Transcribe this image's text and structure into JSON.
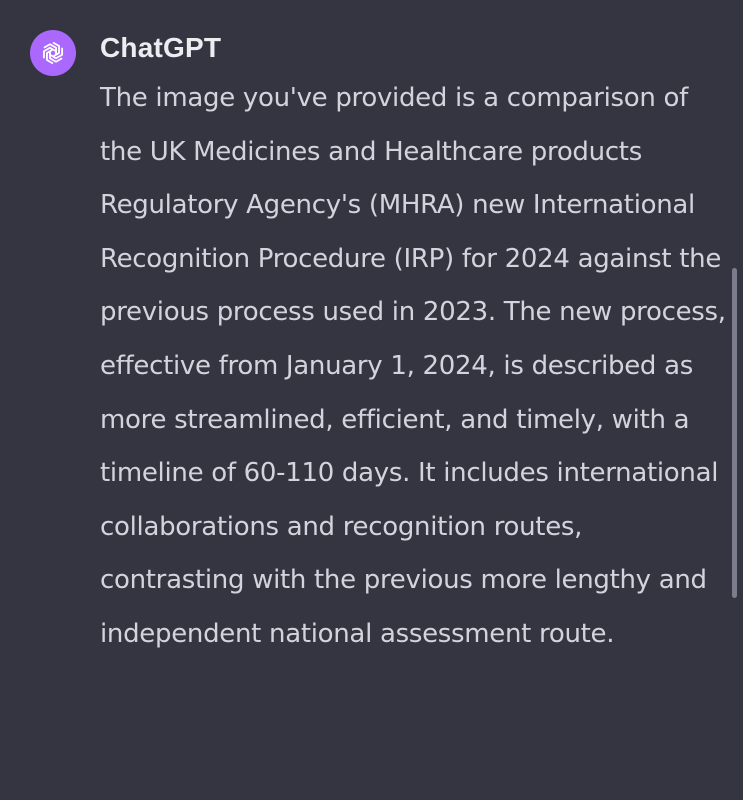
{
  "message": {
    "author": "ChatGPT",
    "avatar_icon": "openai-logo-icon",
    "avatar_color": "#ab68ff",
    "text": "The image you've provided is a comparison of the UK Medicines and Healthcare products Regulatory Agency's (MHRA) new International Recognition Procedure (IRP) for 2024 against the previous process used in 2023. The new process, effective from January 1, 2024, is described as more streamlined, efficient, and timely, with a timeline of 60-110 days. It includes international collaborations and recognition routes, contrasting with the previous more lengthy and independent national assessment route."
  },
  "colors": {
    "background": "#343541",
    "text": "#d1d5db",
    "author": "#ececf1",
    "scrollbar": "#8e8ea0"
  }
}
